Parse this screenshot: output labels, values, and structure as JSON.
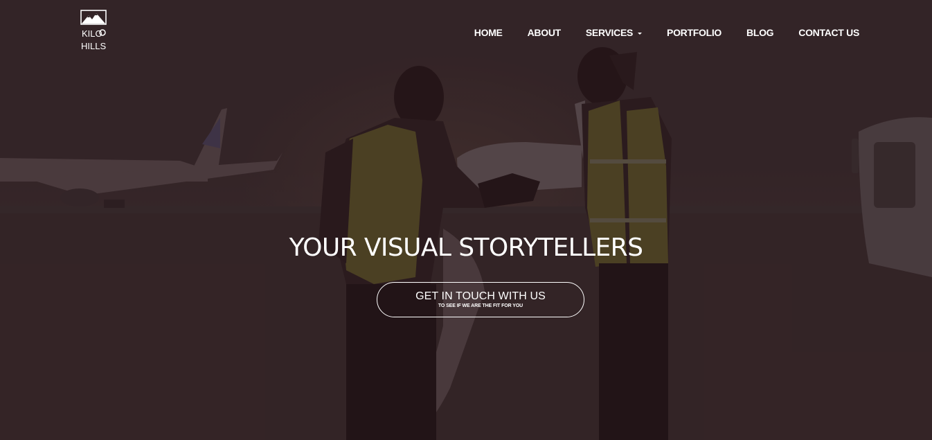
{
  "brand": {
    "logo_line1": "KILO",
    "logo_line2": "HILLS"
  },
  "nav": {
    "items": [
      {
        "label": "HOME"
      },
      {
        "label": "ABOUT"
      },
      {
        "label": "SERVICES"
      },
      {
        "label": "PORTFOLIO"
      },
      {
        "label": "BLOG"
      },
      {
        "label": "CONTACT US"
      }
    ]
  },
  "hero": {
    "headline": "YOUR VISUAL STORYTELLERS",
    "cta_label": "GET IN TOUCH WITH US",
    "cta_sublabel": "TO SEE IF WE ARE THE FIT FOR YOU"
  },
  "colors": {
    "text": "#ffffff",
    "overlay": "#2a1f20",
    "vest": "#6b6a2a"
  }
}
